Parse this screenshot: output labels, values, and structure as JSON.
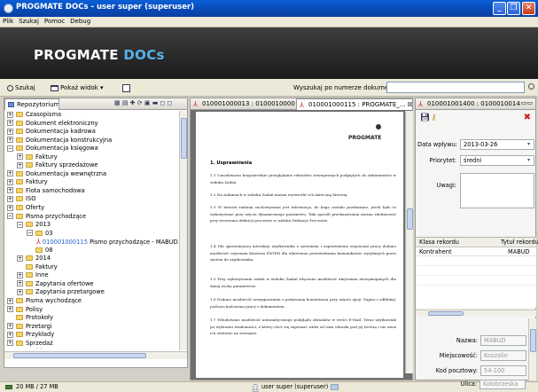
{
  "window": {
    "title": "PROGMATE DOCs - user super (superuser)"
  },
  "menu": [
    "Plik",
    "Szukaj",
    "Pomoc",
    "Debug"
  ],
  "banner": {
    "logo_main": "PROGMATE ",
    "logo_accent": "DOCs"
  },
  "toolbar": {
    "search_label": "Szukaj",
    "show_view_label": "Pokaż widok",
    "doc_number_label": "Wyszukaj po numerze dokumentu:",
    "doc_number_value": ""
  },
  "repo": {
    "title": "Repozytorium",
    "tree": [
      {
        "label": "Czasopisma",
        "exp": "+",
        "level": 0
      },
      {
        "label": "Dokument elektroniczny",
        "exp": "+",
        "level": 0
      },
      {
        "label": "Dokumentacja kadrowa",
        "exp": "+",
        "level": 0
      },
      {
        "label": "Dokumentacja konstrukcyjna",
        "exp": "+",
        "level": 0
      },
      {
        "label": "Dokumentacja księgowa",
        "exp": "-",
        "level": 0
      },
      {
        "label": "Faktury",
        "exp": "+",
        "level": 1
      },
      {
        "label": "Faktury sprzedażowe",
        "exp": "+",
        "level": 1
      },
      {
        "label": "Dokumentacja wewnętrzna",
        "exp": "+",
        "level": 0
      },
      {
        "label": "Faktury",
        "exp": "+",
        "level": 0
      },
      {
        "label": "Flota samochodowa",
        "exp": "+",
        "level": 0
      },
      {
        "label": "ISO",
        "exp": "+",
        "level": 0
      },
      {
        "label": "Oferty",
        "exp": "+",
        "level": 0
      },
      {
        "label": "Pisma przychodzące",
        "exp": "-",
        "level": 0
      },
      {
        "label": "2013",
        "exp": "-",
        "level": 1
      },
      {
        "label": "03",
        "exp": "-",
        "level": 2
      },
      {
        "doc": "010001000115",
        "label": " Pismo przychodzące - MABUD",
        "level": 3,
        "kind": "doc"
      },
      {
        "label": "08",
        "exp": "",
        "level": 2
      },
      {
        "label": "2014",
        "exp": "+",
        "level": 1
      },
      {
        "label": "Faktury",
        "exp": "",
        "level": 1
      },
      {
        "label": "Inne",
        "exp": "+",
        "level": 1
      },
      {
        "label": "Zapytania ofertowe",
        "exp": "+",
        "level": 1
      },
      {
        "label": "Zapytania przetargowe",
        "exp": "+",
        "level": 1
      },
      {
        "label": "Pisma wychodzące",
        "exp": "+",
        "level": 0
      },
      {
        "label": "Polisy",
        "exp": "+",
        "level": 0
      },
      {
        "label": "Protokoły",
        "exp": "",
        "level": 0
      },
      {
        "label": "Przetargi",
        "exp": "+",
        "level": 0
      },
      {
        "label": "Przykłady",
        "exp": "+",
        "level": 0
      },
      {
        "label": "Sprzedaż",
        "exp": "+",
        "level": 0
      },
      {
        "label": "Szablony",
        "exp": "+",
        "level": 0
      }
    ]
  },
  "doc_tabs": [
    {
      "label": "010001000013 : 0100010000..."
    },
    {
      "label": "010001000115 : PROGMATE_..."
    },
    {
      "label": "010001001400 : 0100010014..."
    }
  ],
  "document": {
    "logo": "PROGMATE",
    "heading": "1.  Usprawnienia",
    "paragraphs": [
      "1.1  Umożliwiono bezpośrednie przeglądanie rekordów zewnętrznych podpiętych do dokumentów w widoku Zadań.",
      "1.2  Na zadaniach w widoku Zadań można wyświetlić ich skróconą historię.",
      "1.3  W historii zadania zachowywana jest informacja, do kogo zostało przekazane, jeżeli było to wykonywane przy użyciu dynamicznego parametru. Taki sposób przekazywania można zdefiniować przy tworzeniu definicji procesów w widoku Definicje Procesów.",
      "1.4  Dla sprawniejszej interakcji użytkownika z systemem i usprawnienia ergonomii pracy dodano możliwość używania klawisza ENTER dla ułatwienia potwierdzania komunikatów wysyłanych przez system do użytkownika.",
      "1.5  Przy wykonywaniu zadań w widoku Zadań włączono możliwość ukrywania niewymaganych dla danej osoby parametrów.",
      "1.6  Dodano możliwość zrezygnowania z podawania komentarza przy użyciu opcji 'Zapisz i odbłokuj' podczas kończenia pracy z dokumentem.",
      "1.7  Wbudowano możliwość automatycznego podglądu obrazków w treści E-Mail. Teraz użytkownik po wybraniu wiadomości, z której chce się zapoznać widzi od razu obrazki pod jej treścią i nie musi ich otwierać na zewnątrz."
    ]
  },
  "properties": {
    "date_label": "Data wpływu:",
    "date_value": "2013-03-26",
    "priority_label": "Priorytet:",
    "priority_value": "średni",
    "remarks_label": "Uwagi:",
    "remarks_value": "",
    "table_headers": [
      "Klasa rekordu",
      "Tytuł rekordu"
    ],
    "table_rows": [
      [
        "Kontrahent",
        "MABUD"
      ]
    ],
    "name_label": "Nazwa:",
    "name_value": "MABUD",
    "city_label": "Miejscowość:",
    "city_value": "Koszalin",
    "zip_label": "Kod pocztowy:",
    "zip_value": "54-100",
    "street_label": "Ulica:",
    "street_value": "Kołobrzeska"
  },
  "status": {
    "memory": "20 MB / 27 MB",
    "user": "user super (superuser)"
  },
  "colors": {
    "titlebar": "#0a5fd6",
    "banner": "#1f1f1f",
    "logo_accent": "#56b3ea",
    "link": "#1f5fcf",
    "close_red": "#d01e1e"
  }
}
